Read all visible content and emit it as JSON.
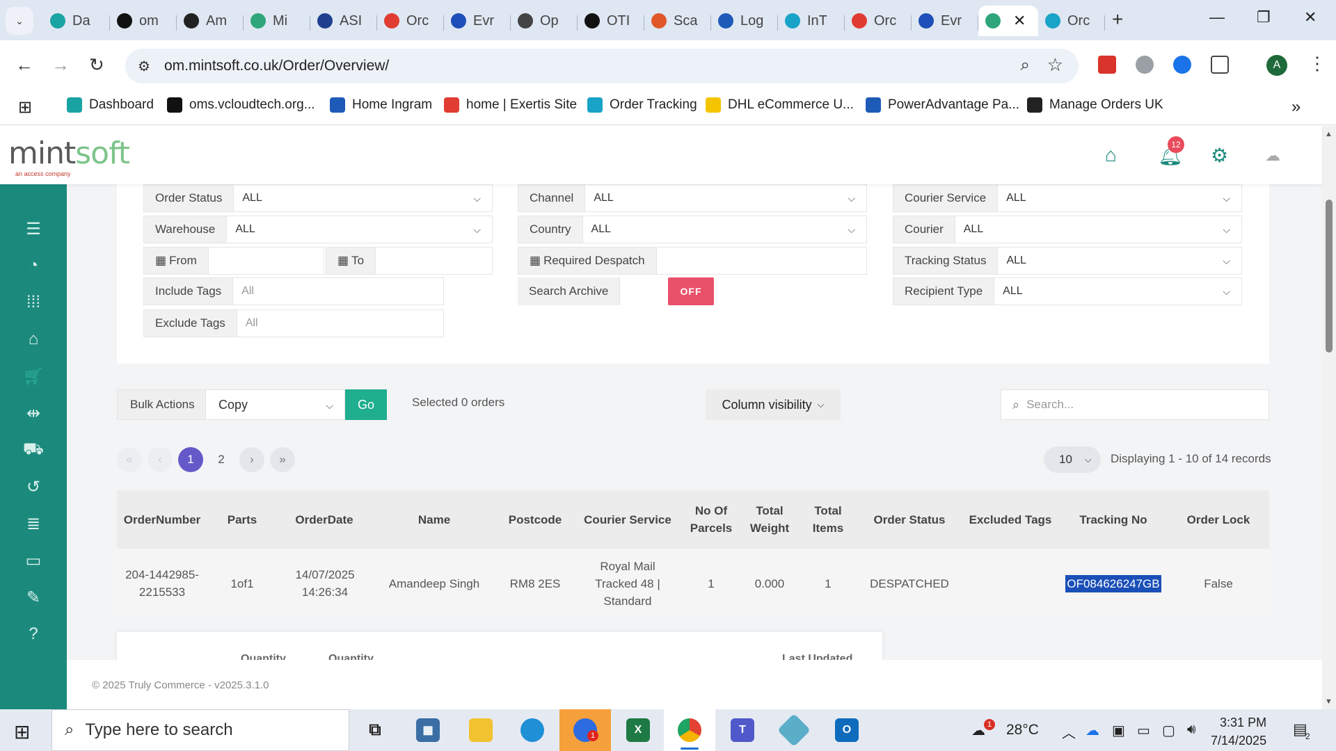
{
  "browser": {
    "tabs": [
      {
        "label": "Da",
        "icon_color": "#1aa3a3"
      },
      {
        "label": "om",
        "icon_color": "#111111"
      },
      {
        "label": "Am",
        "icon_color": "#222222"
      },
      {
        "label": "Mi",
        "icon_color": "#2fa67a"
      },
      {
        "label": "ASI",
        "icon_color": "#1f3f8f"
      },
      {
        "label": "Orc",
        "icon_color": "#e03c31"
      },
      {
        "label": "Evr",
        "icon_color": "#1f4fb8"
      },
      {
        "label": "Op",
        "icon_color": "#444444"
      },
      {
        "label": "OTI",
        "icon_color": "#111111"
      },
      {
        "label": "Sca",
        "icon_color": "#e0582a"
      },
      {
        "label": "Log",
        "icon_color": "#1e5bb8"
      },
      {
        "label": "InT",
        "icon_color": "#19a3c8"
      },
      {
        "label": "Orc",
        "icon_color": "#e03c31"
      },
      {
        "label": "Evr",
        "icon_color": "#1f4fb8"
      }
    ],
    "active_tab_icon_color": "#2fa67a",
    "last_tab": {
      "label": "Orc",
      "icon_color": "#19a3c8"
    },
    "url": "om.mintsoft.co.uk/Order/Overview/",
    "profile_initial": "A",
    "bookmarks": [
      {
        "label": "Dashboard",
        "icon_color": "#1aa3a3"
      },
      {
        "label": "oms.vcloudtech.org...",
        "icon_color": "#111111"
      },
      {
        "label": "Home Ingram",
        "icon_color": "#1e5bb8"
      },
      {
        "label": "home | Exertis Site",
        "icon_color": "#e03c31"
      },
      {
        "label": "Order Tracking",
        "icon_color": "#19a3c8"
      },
      {
        "label": "DHL eCommerce U...",
        "icon_color": "#f5c400"
      },
      {
        "label": "PowerAdvantage Pa...",
        "icon_color": "#1e5bb8"
      },
      {
        "label": "Manage Orders UK",
        "icon_color": "#222222"
      }
    ]
  },
  "app": {
    "logo": {
      "prefix": "mint",
      "suffix": "soft",
      "subline": "an access company"
    },
    "notifications_count": "12",
    "accent_color": "#1b8a7d"
  },
  "filters": {
    "order_status": {
      "label": "Order Status",
      "value": "ALL"
    },
    "warehouse": {
      "label": "Warehouse",
      "value": "ALL"
    },
    "from": {
      "label": "From",
      "value": ""
    },
    "to": {
      "label": "To",
      "value": ""
    },
    "include_tags": {
      "label": "Include Tags",
      "placeholder": "All"
    },
    "exclude_tags": {
      "label": "Exclude Tags",
      "placeholder": "All"
    },
    "channel": {
      "label": "Channel",
      "value": "ALL"
    },
    "country": {
      "label": "Country",
      "value": "ALL"
    },
    "required_despatch": {
      "label": "Required Despatch",
      "value": ""
    },
    "search_archive": {
      "label": "Search Archive",
      "toggle": "OFF"
    },
    "courier_service": {
      "label": "Courier Service",
      "value": "ALL"
    },
    "courier": {
      "label": "Courier",
      "value": "ALL"
    },
    "tracking_status": {
      "label": "Tracking Status",
      "value": "ALL"
    },
    "recipient_type": {
      "label": "Recipient Type",
      "value": "ALL"
    }
  },
  "actions": {
    "bulk_label": "Bulk Actions",
    "bulk_value": "Copy",
    "go_label": "Go",
    "selected_text": "Selected 0 orders",
    "column_visibility": "Column visibility",
    "search_placeholder": "Search..."
  },
  "pagination": {
    "pages": [
      "1",
      "2"
    ],
    "current": "1",
    "per_page": "10",
    "displaying": "Displaying 1 - 10 of 14 records"
  },
  "table": {
    "headers": [
      "OrderNumber",
      "Parts",
      "OrderDate",
      "Name",
      "Postcode",
      "Courier Service",
      "No Of Parcels",
      "Total Weight",
      "Total Items",
      "Order Status",
      "Excluded Tags",
      "Tracking No",
      "Order Lock"
    ],
    "rows": [
      {
        "order_number": "204-1442985-2215533",
        "parts": "1of1",
        "order_date": "14/07/2025 14:26:34",
        "name": "Amandeep Singh",
        "postcode": "RM8 2ES",
        "courier_service": "Royal Mail Tracked 48 | Standard",
        "parcels": "1",
        "total_weight": "0.000",
        "total_items": "1",
        "order_status": "DESPATCHED",
        "excluded_tags": "",
        "tracking_no": "OF084626247GB",
        "order_lock": "False"
      }
    ],
    "subtable_headers": [
      "Quantity",
      "Quantity",
      "Last Updated"
    ]
  },
  "footer": {
    "copyright": "© 2025 Truly Commerce - v2025.3.1.0"
  },
  "taskbar": {
    "search_placeholder": "Type here to search",
    "weather_temp": "28°C",
    "weather_badge": "1",
    "zoom_badge": "1",
    "time": "3:31 PM",
    "date": "7/14/2025",
    "notification_count": "2"
  }
}
